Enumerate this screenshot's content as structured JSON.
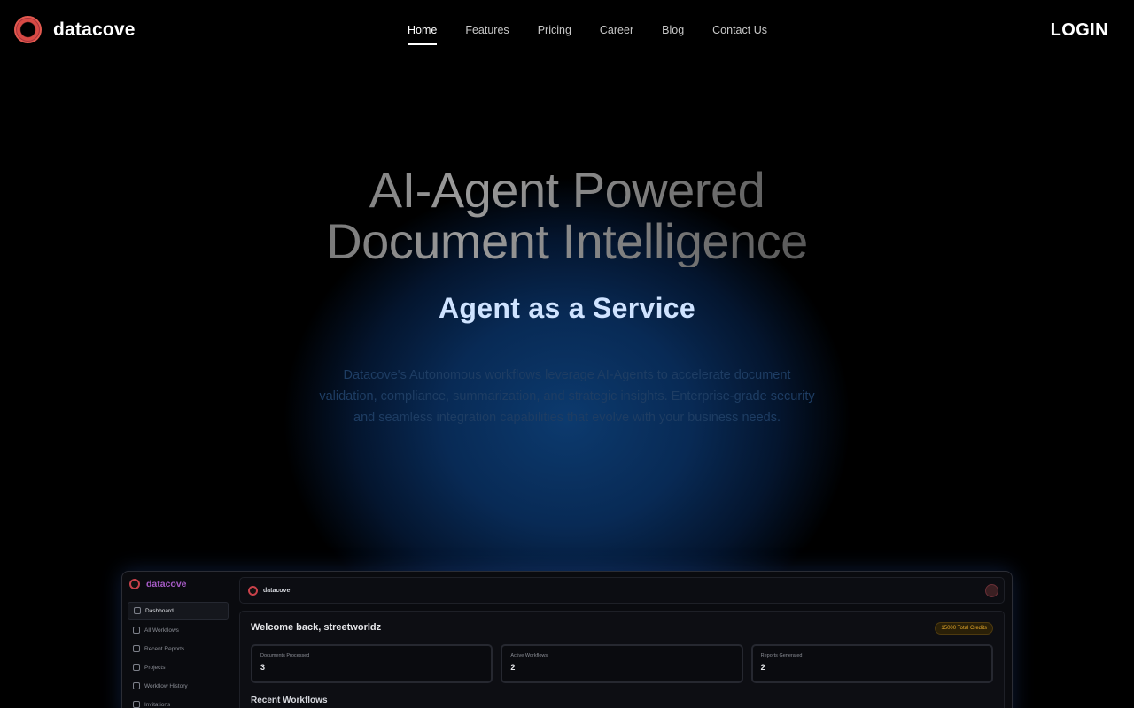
{
  "nav": {
    "brand": "datacove",
    "items": [
      {
        "label": "Home",
        "active": true
      },
      {
        "label": "Features"
      },
      {
        "label": "Pricing"
      },
      {
        "label": "Career"
      },
      {
        "label": "Blog"
      },
      {
        "label": "Contact Us"
      }
    ],
    "login": "LOGIN"
  },
  "hero": {
    "title_line1": "AI-Agent Powered",
    "title_line2": "Document Intelligence",
    "subtitle": "Agent as a Service",
    "description": "Datacove's Autonomous workflows leverage AI-Agents to accelerate document validation, compliance, summarization, and strategic insights. Enterprise-grade security and seamless integration capabilities that evolve with your business needs."
  },
  "preview": {
    "brand": "datacove",
    "sidebar": [
      {
        "label": "Dashboard",
        "icon": "grid-icon",
        "active": true
      },
      {
        "label": "All Workflows",
        "icon": "document-icon"
      },
      {
        "label": "Recent Reports",
        "icon": "report-icon"
      },
      {
        "label": "Projects",
        "icon": "folder-icon"
      },
      {
        "label": "Workflow History",
        "icon": "history-icon"
      },
      {
        "label": "Invitations",
        "icon": "user-icon"
      }
    ],
    "topbar_brand": "datacove",
    "welcome": "Welcome back, streetworldz",
    "credits": "15000 Total Credits",
    "cards": [
      {
        "label": "Documents Processed",
        "value": "3"
      },
      {
        "label": "Active Workflows",
        "value": "2"
      },
      {
        "label": "Reports Generated",
        "value": "2"
      }
    ],
    "recent_title": "Recent Workflows"
  },
  "colors": {
    "accent_red": "#d84a45",
    "subtitle_blue": "#cfe3ff",
    "glow_blue": "#0c3a6e",
    "credits_amber": "#e0a52a"
  }
}
